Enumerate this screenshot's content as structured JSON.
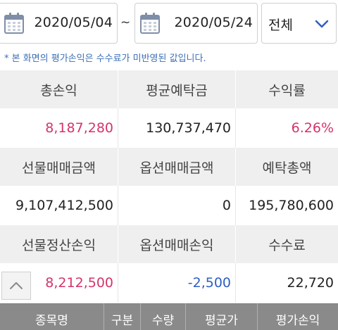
{
  "filters": {
    "start_date": "2020/05/04",
    "separator": "~",
    "end_date": "2020/05/24",
    "type_select": "전체"
  },
  "notice": "* 본 화면의 평가손익은 수수료가 미반영된 값입니다.",
  "summary": {
    "row1_labels": [
      "총손익",
      "평균예탁금",
      "수익률"
    ],
    "row1_values": [
      "8,187,280",
      "130,737,470",
      "6.26%"
    ],
    "row2_labels": [
      "선물매매금액",
      "옵션매매금액",
      "예탁총액"
    ],
    "row2_values": [
      "9,107,412,500",
      "0",
      "195,780,600"
    ],
    "row3_labels": [
      "선물정산손익",
      "옵션매매손익",
      "수수료"
    ],
    "row3_values": [
      "8,212,500",
      "-2,500",
      "22,720"
    ]
  },
  "table": {
    "columns": [
      "종목명",
      "구분",
      "수량",
      "평균가",
      "평가손익"
    ]
  },
  "colors": {
    "positive": "#d6336c",
    "negative": "#2f5fc4",
    "header_bg": "#efefef",
    "table_header_bg": "#8a8a8a",
    "accent": "#3b6fb6"
  },
  "icons": {
    "calendar": "calendar-icon",
    "chevron": "chevron-down-icon",
    "scroll_up": "chevron-up-icon"
  }
}
